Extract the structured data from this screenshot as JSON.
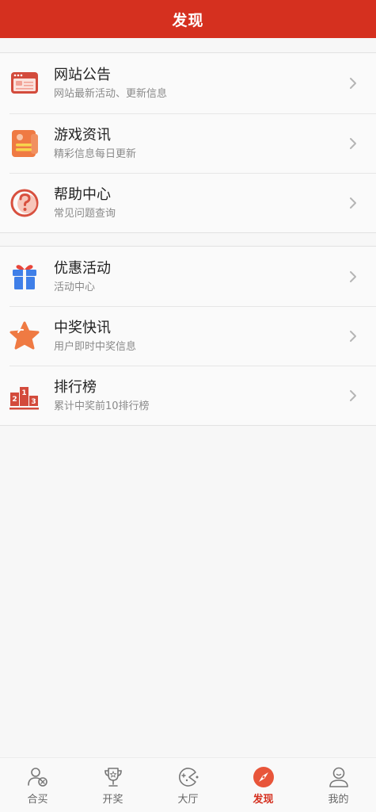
{
  "header": {
    "title": "发现"
  },
  "groups": [
    {
      "items": [
        {
          "title": "网站公告",
          "subtitle": "网站最新活动、更新信息",
          "icon": "announcement-icon"
        },
        {
          "title": "游戏资讯",
          "subtitle": "精彩信息每日更新",
          "icon": "news-icon"
        },
        {
          "title": "帮助中心",
          "subtitle": "常见问题查询",
          "icon": "help-icon"
        }
      ]
    },
    {
      "items": [
        {
          "title": "优惠活动",
          "subtitle": "活动中心",
          "icon": "gift-icon"
        },
        {
          "title": "中奖快讯",
          "subtitle": "用户即时中奖信息",
          "icon": "star-icon"
        },
        {
          "title": "排行榜",
          "subtitle": "累计中奖前10排行榜",
          "icon": "podium-icon",
          "podium_numbers": [
            "2",
            "1",
            "3"
          ]
        }
      ]
    }
  ],
  "tabbar": {
    "tabs": [
      {
        "label": "合买",
        "icon": "group-buy-icon"
      },
      {
        "label": "开奖",
        "icon": "trophy-icon"
      },
      {
        "label": "大厅",
        "icon": "lobby-icon"
      },
      {
        "label": "发现",
        "icon": "compass-icon",
        "active": true
      },
      {
        "label": "我的",
        "icon": "profile-icon"
      }
    ]
  },
  "colors": {
    "primary": "#d5301f",
    "accent_orange": "#ef7a43",
    "gift_blue": "#3f7fe8"
  }
}
